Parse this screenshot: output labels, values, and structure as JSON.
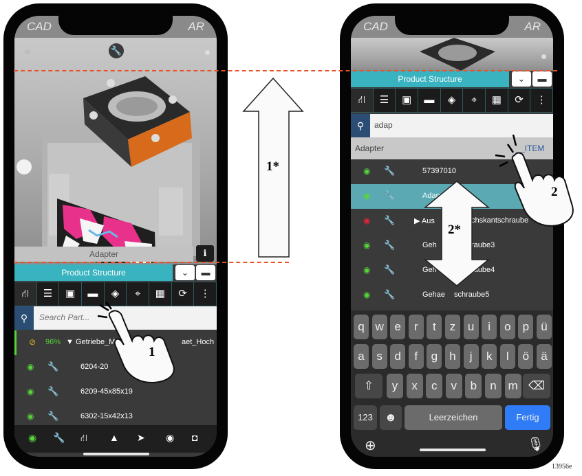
{
  "left_phone": {
    "header": {
      "left": "CAD",
      "right": "AR"
    },
    "model_label": "Adapter",
    "panel_title": "Product Structure",
    "search_placeholder": "Search Part...",
    "rows": [
      {
        "percent": "96%",
        "label": "▼ Getriebe_M",
        "label_tail": "aet_Hoch"
      },
      {
        "label": "6204-20"
      },
      {
        "label": "6209-45x85x19"
      },
      {
        "label": "6302-15x42x13"
      }
    ]
  },
  "right_phone": {
    "header": {
      "left": "CAD",
      "right": "AR"
    },
    "panel_title": "Product Structure",
    "search_value": "adap",
    "result_label": "Adapter",
    "result_tag": "_ITEM",
    "rows": [
      {
        "label": "57397010"
      },
      {
        "label": "Adap"
      },
      {
        "label": "▶ Aus",
        "label_tail": "chskantschraube"
      },
      {
        "label": "Geh",
        "label_tail": "raube3"
      },
      {
        "label": "Geh",
        "label_tail": "raube4"
      },
      {
        "label": "Gehae",
        "label_tail": "schraube5"
      }
    ],
    "keyboard": {
      "row1": [
        "q",
        "w",
        "e",
        "r",
        "t",
        "z",
        "u",
        "i",
        "o",
        "p",
        "ü"
      ],
      "row2": [
        "a",
        "s",
        "d",
        "f",
        "g",
        "h",
        "j",
        "k",
        "l",
        "ö",
        "ä"
      ],
      "row3": [
        "y",
        "x",
        "c",
        "v",
        "b",
        "n",
        "m"
      ],
      "numbers_key": "123",
      "space_key": "Leerzeichen",
      "done_key": "Fertig"
    }
  },
  "callouts": {
    "c1": "1",
    "c1_star": "1*",
    "c2": "2",
    "c2_star": "2*"
  },
  "figure_code": "13956e",
  "colors": {
    "teal": "#39b3bf",
    "green": "#57d43a",
    "red": "#e0243a",
    "blue_key": "#2f7cf6",
    "dash": "#e5532b"
  }
}
